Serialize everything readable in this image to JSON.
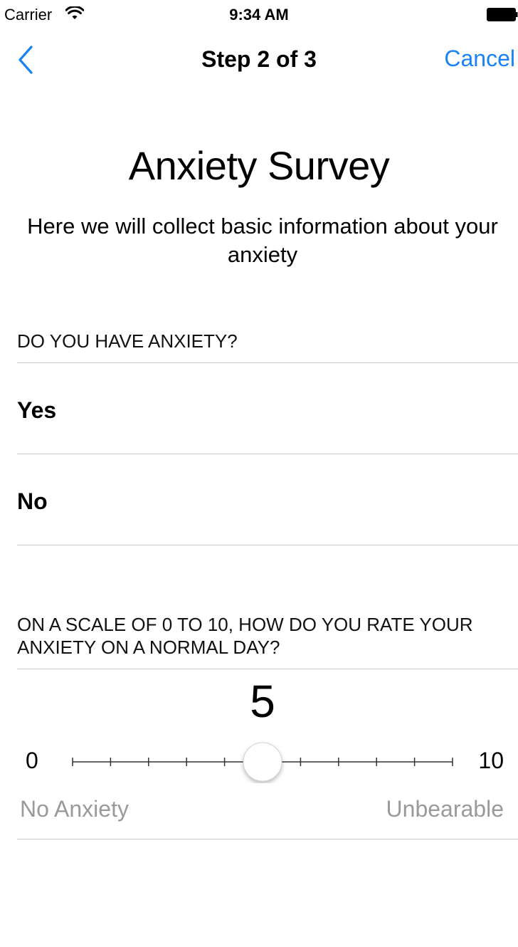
{
  "status_bar": {
    "carrier": "Carrier",
    "time": "9:34 AM",
    "wifi_icon": "wifi-icon",
    "battery_icon": "battery-icon"
  },
  "nav": {
    "back_icon": "chevron-left-icon",
    "title": "Step 2 of 3",
    "cancel_label": "Cancel",
    "accent_color": "#1a82f3"
  },
  "header": {
    "title": "Anxiety Survey",
    "subtitle": "Here we will collect basic information about your anxiety"
  },
  "question1": {
    "label": "DO YOU HAVE ANXIETY?",
    "options": [
      {
        "label": "Yes"
      },
      {
        "label": "No"
      }
    ]
  },
  "question2": {
    "label": "ON A SCALE OF 0 TO 10, HOW DO YOU RATE YOUR ANXIETY ON A NORMAL DAY?",
    "slider": {
      "value": 5,
      "value_text": "5",
      "min": 0,
      "max": 10,
      "min_text": "0",
      "max_text": "10",
      "min_description": "No Anxiety",
      "max_description": "Unbearable",
      "step": 1
    }
  }
}
